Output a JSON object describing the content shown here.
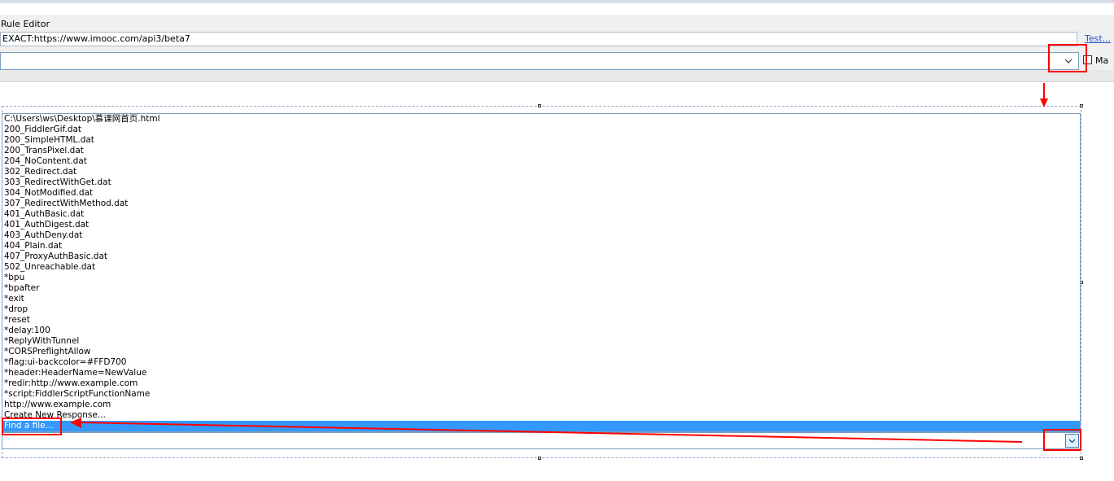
{
  "rule_editor": {
    "title": "Rule Editor",
    "match_value": "EXACT:https://www.imooc.com/api3/beta7",
    "test_link": "Test...",
    "action_value": "",
    "match_checkbox_label": "Ma",
    "match_checkbox_checked": false
  },
  "response_list": {
    "items": [
      "C:\\Users\\ws\\Desktop\\慕课网首页.html",
      "200_FiddlerGif.dat",
      "200_SimpleHTML.dat",
      "200_TransPixel.dat",
      "204_NoContent.dat",
      "302_Redirect.dat",
      "303_RedirectWithGet.dat",
      "304_NotModified.dat",
      "307_RedirectWithMethod.dat",
      "401_AuthBasic.dat",
      "401_AuthDigest.dat",
      "403_AuthDeny.dat",
      "404_Plain.dat",
      "407_ProxyAuthBasic.dat",
      "502_Unreachable.dat",
      "*bpu",
      "*bpafter",
      "*exit",
      "*drop",
      "*reset",
      "*delay:100",
      "*ReplyWithTunnel",
      "*CORSPreflightAllow",
      "*flag:ui-backcolor=#FFD700",
      "*header:HeaderName=NewValue",
      "*redir:http://www.example.com",
      "*script:FiddlerScriptFunctionName",
      "http://www.example.com",
      "Create New Response...",
      "Find a file..."
    ],
    "selected_index": 29,
    "combo_value": ""
  },
  "icons": {
    "dropdown_arrow": "chevron-down-icon"
  },
  "colors": {
    "selection": "#3399ff",
    "annotation": "#ff0000",
    "link": "#2050c8"
  }
}
